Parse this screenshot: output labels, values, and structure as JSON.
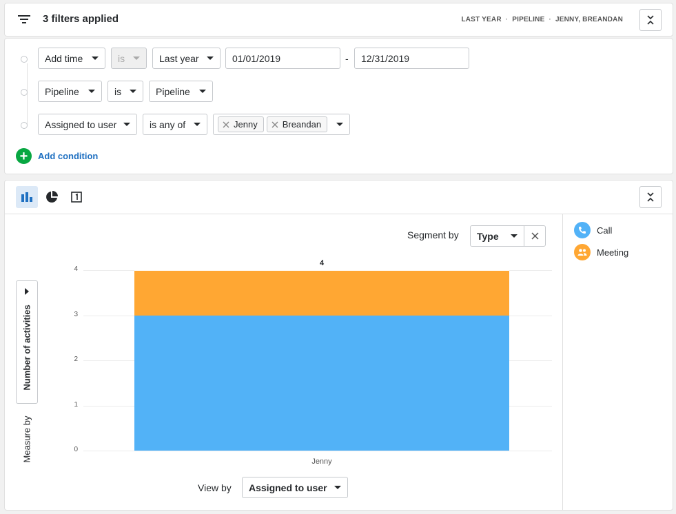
{
  "filters_header": {
    "title": "3 filters applied",
    "summary": [
      "LAST YEAR",
      "PIPELINE",
      "JENNY, BREANDAN"
    ],
    "separator": "·"
  },
  "conditions": {
    "row1": {
      "field": "Add time",
      "operator": "is",
      "value": "Last year",
      "from_date": "01/01/2019",
      "dash": "-",
      "to_date": "12/31/2019"
    },
    "row2": {
      "field": "Pipeline",
      "operator": "is",
      "value": "Pipeline"
    },
    "row3": {
      "field": "Assigned to user",
      "operator": "is any of",
      "users": [
        "Jenny",
        "Breandan"
      ]
    },
    "add_label": "Add condition",
    "add_symbol": "+"
  },
  "chart_toolbar": {
    "active_view": "bar-chart"
  },
  "segment": {
    "label": "Segment by",
    "value": "Type"
  },
  "measure": {
    "label": "Measure by",
    "value": "Number of activities"
  },
  "view_by": {
    "label": "View by",
    "value": "Assigned to user"
  },
  "legend": [
    {
      "label": "Call",
      "color": "#52b2f7",
      "icon": "phone-icon"
    },
    {
      "label": "Meeting",
      "color": "#ffa733",
      "icon": "people-icon"
    }
  ],
  "chart_data": {
    "type": "bar",
    "stacked": true,
    "categories": [
      "Jenny"
    ],
    "series": [
      {
        "name": "Call",
        "values": [
          3
        ],
        "color": "#52b2f7"
      },
      {
        "name": "Meeting",
        "values": [
          1
        ],
        "color": "#ffa733"
      }
    ],
    "totals": [
      4
    ],
    "total_labels": [
      "4"
    ],
    "ylim": [
      0,
      4
    ],
    "yticks": [
      0,
      1,
      2,
      3,
      4
    ],
    "ytick_labels": [
      "0",
      "1",
      "2",
      "3",
      "4"
    ],
    "xlabel": "Assigned to user",
    "ylabel": "Number of activities",
    "grid": true,
    "legend_position": "right"
  }
}
